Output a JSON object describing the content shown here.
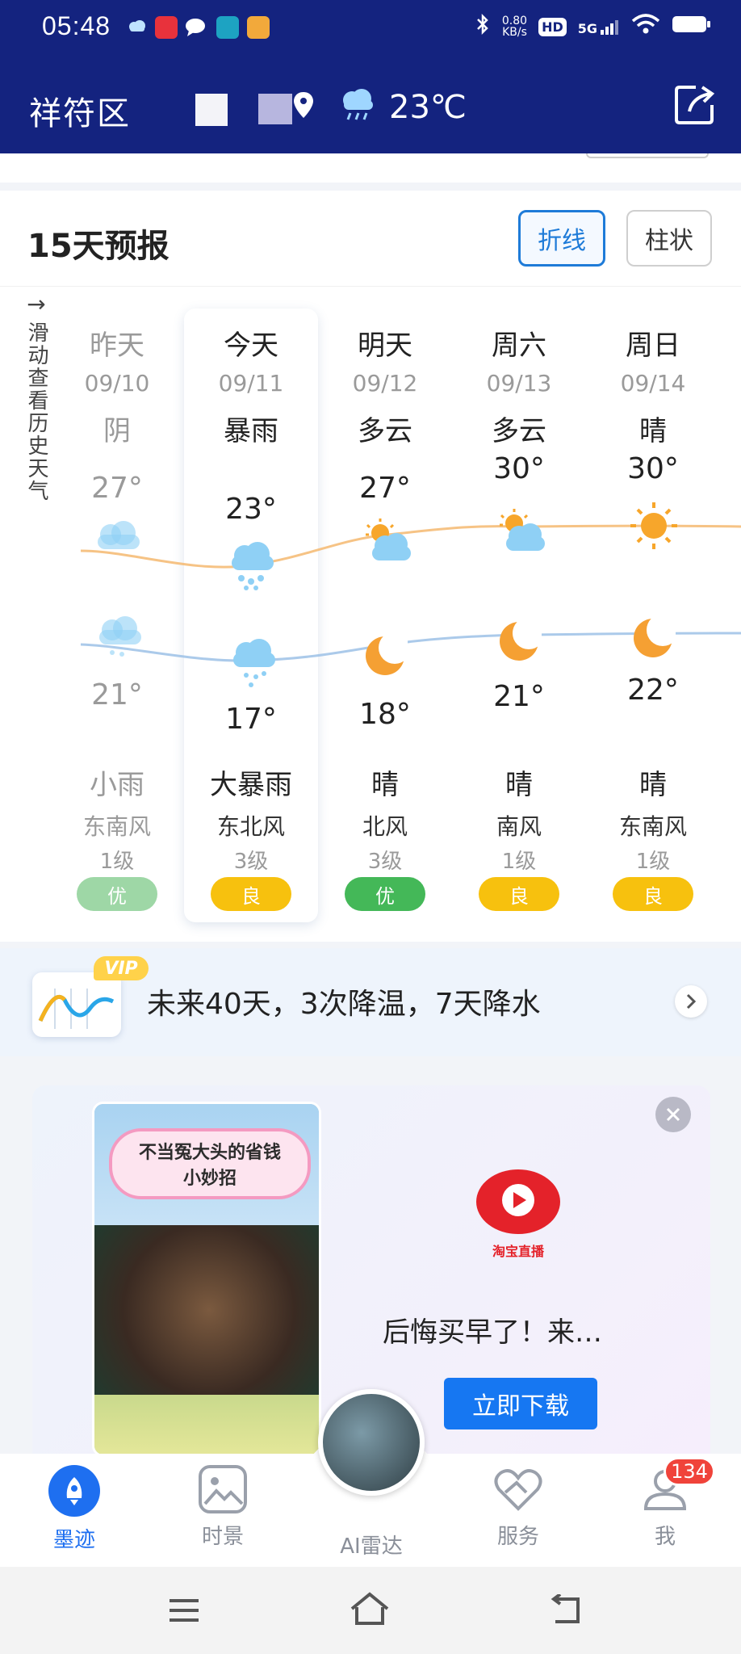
{
  "status_bar": {
    "time": "05:48",
    "net_speed_top": "0.80",
    "net_speed_unit": "KB/s",
    "hd": "HD",
    "network": "5G"
  },
  "header": {
    "location": "祥符区",
    "temperature": "23℃",
    "icons": [
      "location-pin-icon",
      "rain-cloud-icon",
      "share-icon"
    ]
  },
  "forecast": {
    "title": "15天预报",
    "toggle_line": "折线",
    "toggle_bar": "柱状",
    "scroll_hint": "滑动查看历史天气",
    "scroll_arrow": "→",
    "days": [
      {
        "name": "昨天",
        "date": "09/10",
        "day_weather": "阴",
        "high": "27°",
        "low": "21°",
        "night_weather": "小雨",
        "wind": "东南风",
        "level": "1级",
        "aqi": "优",
        "past": true
      },
      {
        "name": "今天",
        "date": "09/11",
        "day_weather": "暴雨",
        "high": "23°",
        "low": "17°",
        "night_weather": "大暴雨",
        "wind": "东北风",
        "level": "3级",
        "aqi": "良",
        "past": false
      },
      {
        "name": "明天",
        "date": "09/12",
        "day_weather": "多云",
        "high": "27°",
        "low": "18°",
        "night_weather": "晴",
        "wind": "北风",
        "level": "3级",
        "aqi": "优",
        "past": false
      },
      {
        "name": "周六",
        "date": "09/13",
        "day_weather": "多云",
        "high": "30°",
        "low": "21°",
        "night_weather": "晴",
        "wind": "南风",
        "level": "1级",
        "aqi": "良",
        "past": false
      },
      {
        "name": "周日",
        "date": "09/14",
        "day_weather": "晴",
        "high": "30°",
        "low": "22°",
        "night_weather": "晴",
        "wind": "东南风",
        "level": "1级",
        "aqi": "良",
        "past": false
      }
    ],
    "colors": {
      "high_line": "#f4b870",
      "low_line": "#9cc1e6",
      "aqi_good": "#44b858",
      "aqi_moderate": "#f7c10e"
    }
  },
  "vip_banner": {
    "badge": "VIP",
    "text": "未来40天，3次降温，7天降水"
  },
  "ad": {
    "image_caption_line1": "不当冤大头的省钱",
    "image_caption_line2": "小妙招",
    "brand": "淘宝直播",
    "headline": "后悔买早了！来…",
    "cta": "立即下载"
  },
  "bottom_nav": {
    "items": [
      {
        "label": "墨迹",
        "icon": "rocket-icon",
        "active": true
      },
      {
        "label": "时景",
        "icon": "photo-icon",
        "active": false
      },
      {
        "label": "AI雷达",
        "icon": "radar-icon",
        "active": false
      },
      {
        "label": "服务",
        "icon": "service-heart-icon",
        "active": false
      },
      {
        "label": "我",
        "icon": "profile-icon",
        "active": false
      }
    ],
    "badge_count": "134"
  }
}
